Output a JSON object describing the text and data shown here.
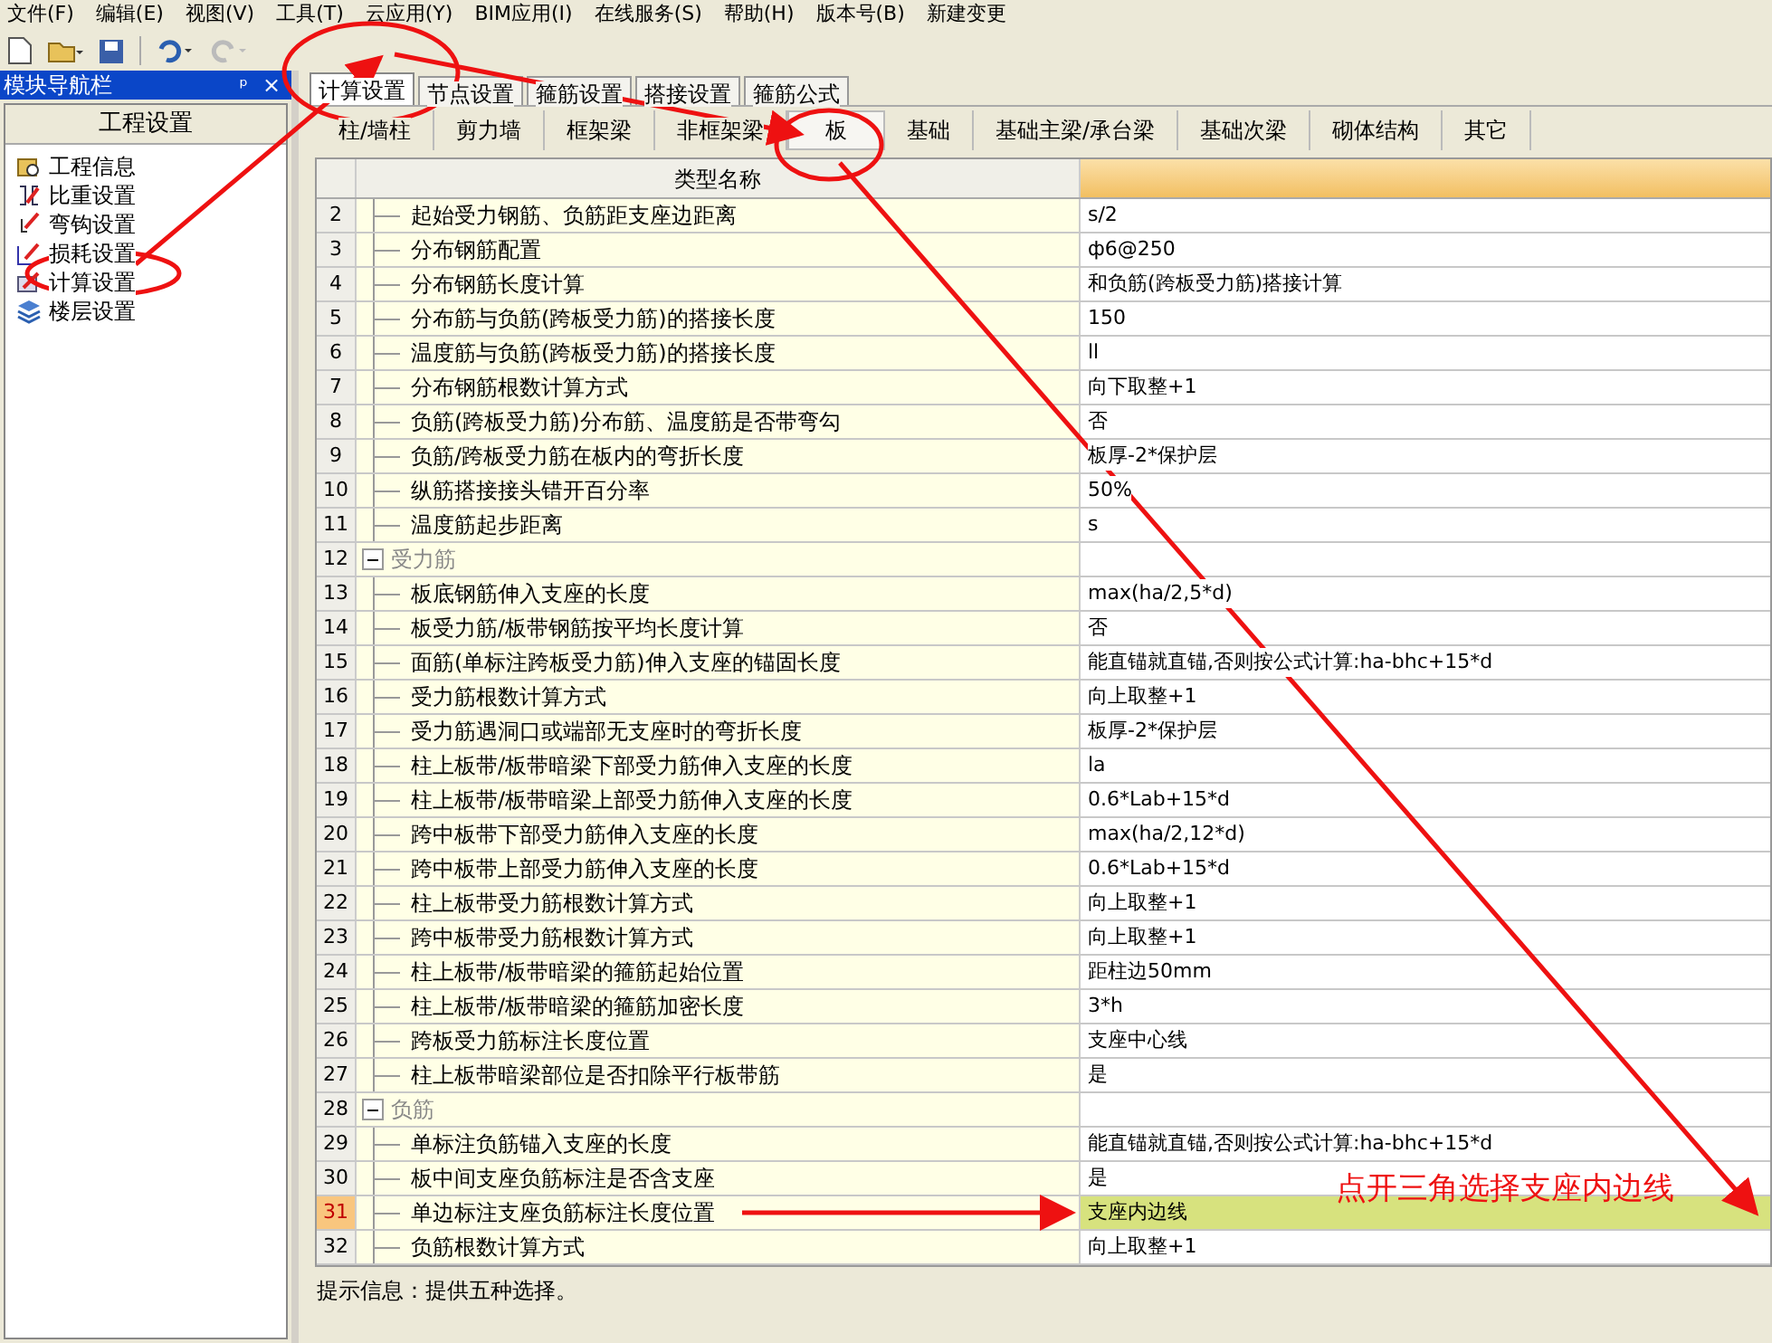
{
  "menu": [
    "文件(F)",
    "编辑(E)",
    "视图(V)",
    "工具(T)",
    "云应用(Y)",
    "BIM应用(I)",
    "在线服务(S)",
    "帮助(H)",
    "版本号(B)",
    "新建变更"
  ],
  "nav": {
    "title": "模块导航栏",
    "pin": "ᵖ",
    "close": "×",
    "section": "工程设置",
    "items": [
      {
        "label": "工程信息",
        "kind": "info"
      },
      {
        "label": "比重设置",
        "kind": "weight"
      },
      {
        "label": "弯钩设置",
        "kind": "hook"
      },
      {
        "label": "损耗设置",
        "kind": "loss"
      },
      {
        "label": "计算设置",
        "kind": "calc"
      },
      {
        "label": "楼层设置",
        "kind": "floor"
      }
    ]
  },
  "tabs": [
    {
      "label": "计算设置",
      "selected": true
    },
    {
      "label": "节点设置",
      "selected": false
    },
    {
      "label": "箍筋设置",
      "selected": false
    },
    {
      "label": "搭接设置",
      "selected": false
    },
    {
      "label": "箍筋公式",
      "selected": false
    }
  ],
  "subtabs": [
    {
      "label": "柱/墙柱",
      "selected": false
    },
    {
      "label": "剪力墙",
      "selected": false
    },
    {
      "label": "框架梁",
      "selected": false
    },
    {
      "label": "非框架梁",
      "selected": false
    },
    {
      "label": "板",
      "selected": true
    },
    {
      "label": "基础",
      "selected": false
    },
    {
      "label": "基础主梁/承台梁",
      "selected": false
    },
    {
      "label": "基础次梁",
      "selected": false
    },
    {
      "label": "砌体结构",
      "selected": false
    },
    {
      "label": "其它",
      "selected": false
    }
  ],
  "table": {
    "column": "类型名称",
    "rows": [
      {
        "num": "2",
        "kind": "item",
        "name": "起始受力钢筋、负筋距支座边距离",
        "value": "s/2",
        "selected": false
      },
      {
        "num": "3",
        "kind": "item",
        "name": "分布钢筋配置",
        "value": "ф6@250",
        "selected": false
      },
      {
        "num": "4",
        "kind": "item",
        "name": "分布钢筋长度计算",
        "value": "和负筋(跨板受力筋)搭接计算",
        "selected": false
      },
      {
        "num": "5",
        "kind": "item",
        "name": "分布筋与负筋(跨板受力筋)的搭接长度",
        "value": "150",
        "selected": false
      },
      {
        "num": "6",
        "kind": "item",
        "name": "温度筋与负筋(跨板受力筋)的搭接长度",
        "value": "ll",
        "selected": false
      },
      {
        "num": "7",
        "kind": "item",
        "name": "分布钢筋根数计算方式",
        "value": "向下取整+1",
        "selected": false
      },
      {
        "num": "8",
        "kind": "item",
        "name": "负筋(跨板受力筋)分布筋、温度筋是否带弯勾",
        "value": "否",
        "selected": false
      },
      {
        "num": "9",
        "kind": "item",
        "name": "负筋/跨板受力筋在板内的弯折长度",
        "value": "板厚-2*保护层",
        "selected": false
      },
      {
        "num": "10",
        "kind": "item",
        "name": "纵筋搭接接头错开百分率",
        "value": "50%",
        "selected": false
      },
      {
        "num": "11",
        "kind": "item",
        "name": "温度筋起步距离",
        "value": "s",
        "selected": false
      },
      {
        "num": "12",
        "kind": "group",
        "name": "受力筋",
        "selected": false
      },
      {
        "num": "13",
        "kind": "item",
        "name": "板底钢筋伸入支座的长度",
        "value": "max(ha/2,5*d)",
        "selected": false
      },
      {
        "num": "14",
        "kind": "item",
        "name": "板受力筋/板带钢筋按平均长度计算",
        "value": "否",
        "selected": false
      },
      {
        "num": "15",
        "kind": "item",
        "name": "面筋(单标注跨板受力筋)伸入支座的锚固长度",
        "value": "能直锚就直锚,否则按公式计算:ha-bhc+15*d",
        "selected": false
      },
      {
        "num": "16",
        "kind": "item",
        "name": "受力筋根数计算方式",
        "value": "向上取整+1",
        "selected": false
      },
      {
        "num": "17",
        "kind": "item",
        "name": "受力筋遇洞口或端部无支座时的弯折长度",
        "value": "板厚-2*保护层",
        "selected": false
      },
      {
        "num": "18",
        "kind": "item",
        "name": "柱上板带/板带暗梁下部受力筋伸入支座的长度",
        "value": "la",
        "selected": false
      },
      {
        "num": "19",
        "kind": "item",
        "name": "柱上板带/板带暗梁上部受力筋伸入支座的长度",
        "value": "0.6*Lab+15*d",
        "selected": false
      },
      {
        "num": "20",
        "kind": "item",
        "name": "跨中板带下部受力筋伸入支座的长度",
        "value": "max(ha/2,12*d)",
        "selected": false
      },
      {
        "num": "21",
        "kind": "item",
        "name": "跨中板带上部受力筋伸入支座的长度",
        "value": "0.6*Lab+15*d",
        "selected": false
      },
      {
        "num": "22",
        "kind": "item",
        "name": "柱上板带受力筋根数计算方式",
        "value": "向上取整+1",
        "selected": false
      },
      {
        "num": "23",
        "kind": "item",
        "name": "跨中板带受力筋根数计算方式",
        "value": "向上取整+1",
        "selected": false
      },
      {
        "num": "24",
        "kind": "item",
        "name": "柱上板带/板带暗梁的箍筋起始位置",
        "value": "距柱边50mm",
        "selected": false
      },
      {
        "num": "25",
        "kind": "item",
        "name": "柱上板带/板带暗梁的箍筋加密长度",
        "value": "3*h",
        "selected": false
      },
      {
        "num": "26",
        "kind": "item",
        "name": "跨板受力筋标注长度位置",
        "value": "支座中心线",
        "selected": false
      },
      {
        "num": "27",
        "kind": "item",
        "name": "柱上板带暗梁部位是否扣除平行板带筋",
        "value": "是",
        "selected": false
      },
      {
        "num": "28",
        "kind": "group",
        "name": "负筋",
        "selected": false
      },
      {
        "num": "29",
        "kind": "item",
        "name": "单标注负筋锚入支座的长度",
        "value": "能直锚就直锚,否则按公式计算:ha-bhc+15*d",
        "selected": false
      },
      {
        "num": "30",
        "kind": "item",
        "name": "板中间支座负筋标注是否含支座",
        "value": "是",
        "selected": false
      },
      {
        "num": "31",
        "kind": "item",
        "name": "单边标注支座负筋标注长度位置",
        "value": "支座内边线",
        "selected": true
      },
      {
        "num": "32",
        "kind": "item",
        "name": "负筋根数计算方式",
        "value": "向上取整+1",
        "selected": false
      }
    ]
  },
  "status": "提示信息：提供五种选择。",
  "annotation": "点开三角选择支座内边线"
}
